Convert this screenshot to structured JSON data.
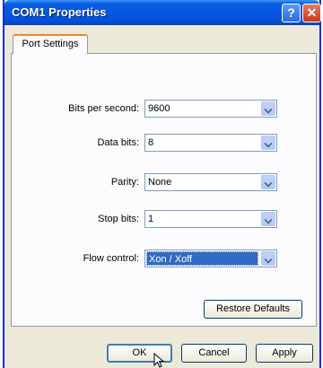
{
  "window": {
    "title": "COM1 Properties",
    "help_glyph": "?",
    "close_glyph": "✕"
  },
  "tabs": [
    {
      "label": "Port Settings",
      "active": true
    }
  ],
  "settings": {
    "bits_per_second": {
      "label": "Bits per second:",
      "value": "9600"
    },
    "data_bits": {
      "label": "Data bits:",
      "value": "8"
    },
    "parity": {
      "label": "Parity:",
      "value": "None"
    },
    "stop_bits": {
      "label": "Stop bits:",
      "value": "1"
    },
    "flow_control": {
      "label": "Flow control:",
      "value": "Xon / Xoff",
      "focused": true
    }
  },
  "buttons": {
    "restore_defaults": "Restore Defaults",
    "ok": "OK",
    "cancel": "Cancel",
    "apply": "Apply"
  },
  "icons": [
    "help-icon",
    "close-icon",
    "chevron-down-icon",
    "mouse-cursor-icon"
  ],
  "colors": {
    "titlebar": "#0655e3",
    "selection": "#316ac5",
    "tab_accent": "#e68b2c"
  }
}
